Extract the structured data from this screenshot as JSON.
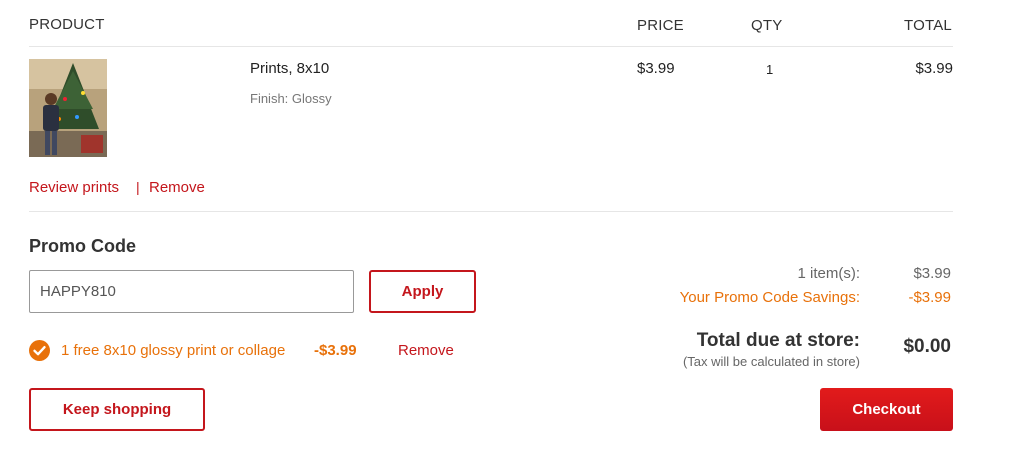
{
  "table_header": {
    "product": "PRODUCT",
    "price": "PRICE",
    "qty": "QTY",
    "total": "TOTAL"
  },
  "item": {
    "name": "Prints, 8x10",
    "finish": "Finish: Glossy",
    "price": "$3.99",
    "qty": "1",
    "total": "$3.99",
    "review_link": "Review prints",
    "separator": "|",
    "remove_link": "Remove"
  },
  "promo": {
    "heading": "Promo Code",
    "input_value": "HAPPY810",
    "apply_label": "Apply",
    "applied_text": "1 free 8x10 glossy print or collage",
    "applied_amount": "-$3.99",
    "remove_label": "Remove"
  },
  "summary": {
    "items_label": "1 item(s):",
    "items_value": "$3.99",
    "savings_label": "Your Promo Code Savings:",
    "savings_value": "-$3.99",
    "total_label": "Total due at store:",
    "total_value": "$0.00",
    "tax_note": "(Tax will be calculated in store)"
  },
  "actions": {
    "keep_shopping": "Keep shopping",
    "checkout": "Checkout"
  },
  "colors": {
    "accent_red": "#c4161c",
    "promo_orange": "#e8710a"
  },
  "icons": {
    "applied_check": "check-circle-icon",
    "product_image": "product-thumbnail"
  }
}
